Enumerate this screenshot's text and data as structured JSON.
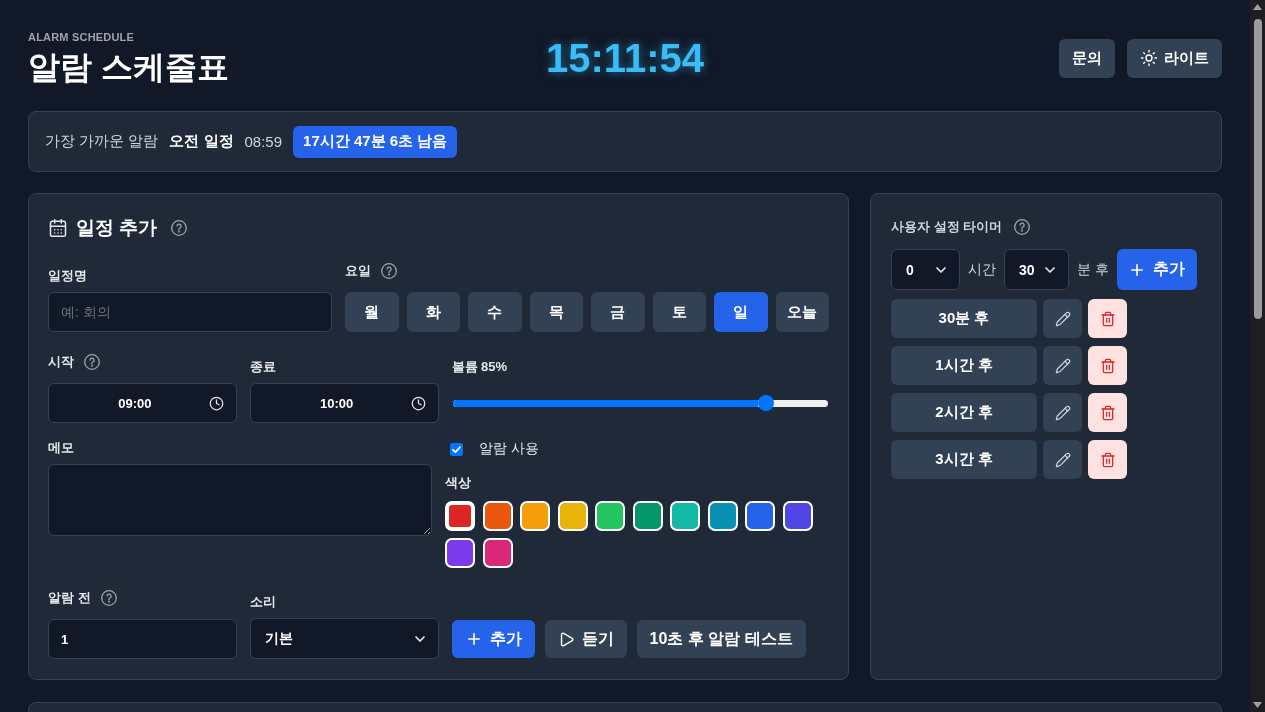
{
  "header": {
    "subtitle": "ALARM SCHEDULE",
    "title": "알람 스케줄표",
    "clock": "15:11:54",
    "buttons": [
      {
        "kind": "plain",
        "label": "문의"
      },
      {
        "kind": "theme",
        "label": "라이트"
      }
    ]
  },
  "next_alarm": {
    "label": "가장 가까운 알람",
    "name": "오전 일정",
    "time": "08:59",
    "remaining": "17시간 47분 6초 남음"
  },
  "schedule_form": {
    "title": {
      "text": "일정 추가",
      "help": true
    },
    "name_field": {
      "label": "일정명",
      "help": false,
      "placeholder": "예: 회의"
    },
    "days": {
      "label": "요일",
      "help": true,
      "items": [
        {
          "label": "월",
          "selected": false
        },
        {
          "label": "화",
          "selected": false
        },
        {
          "label": "수",
          "selected": false
        },
        {
          "label": "목",
          "selected": false
        },
        {
          "label": "금",
          "selected": false
        },
        {
          "label": "토",
          "selected": false
        },
        {
          "label": "일",
          "selected": true
        },
        {
          "label": "오늘",
          "selected": false
        }
      ]
    },
    "start": {
      "label": "시작",
      "help": true,
      "value": "09:00"
    },
    "end": {
      "label": "종료",
      "help": false,
      "value": "10:00"
    },
    "volume": {
      "label": "볼륨 85%",
      "level": 0.85
    },
    "memo": {
      "label": "메모",
      "help": false
    },
    "alarm_enabled": {
      "label": "알람 사용",
      "checked": true
    },
    "colors": {
      "label": "색상",
      "items": [
        {
          "color": "#dc2626",
          "selected": true
        },
        {
          "color": "#ea580c",
          "selected": false
        },
        {
          "color": "#f59e0b",
          "selected": false
        },
        {
          "color": "#eab308",
          "selected": false
        },
        {
          "color": "#22c55e",
          "selected": false
        },
        {
          "color": "#059669",
          "selected": false
        },
        {
          "color": "#14b8a6",
          "selected": false
        },
        {
          "color": "#0891b2",
          "selected": false
        },
        {
          "color": "#2563eb",
          "selected": false
        },
        {
          "color": "#4f46e5",
          "selected": false
        },
        {
          "color": "#7c3aed",
          "selected": false
        },
        {
          "color": "#db2777",
          "selected": false
        }
      ]
    },
    "lead_time": {
      "label": "알람 전",
      "help": true,
      "value": "1"
    },
    "sound": {
      "label": "소리",
      "help": false,
      "value": "기본"
    },
    "buttons": [
      {
        "kind": "add",
        "label": "추가"
      },
      {
        "kind": "play",
        "label": "듣기"
      },
      {
        "kind": "test",
        "label": "10초 후 알람 테스트"
      }
    ]
  },
  "custom_timer": {
    "title": "사용자 설정 타이머",
    "help": true,
    "hours": {
      "value": "0",
      "unit": "시간"
    },
    "minutes": {
      "value": "30",
      "unit": "분 후"
    },
    "add_button": {
      "kind": "add",
      "label": "추가"
    },
    "timers": [
      {
        "label": "30분 후"
      },
      {
        "label": "1시간 후"
      },
      {
        "label": "2시간 후"
      },
      {
        "label": "3시간 후"
      }
    ]
  }
}
